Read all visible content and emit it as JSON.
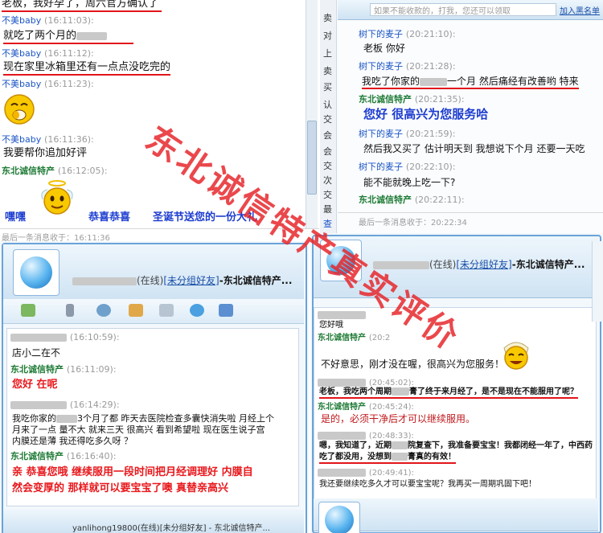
{
  "panel1": {
    "msgs": [
      {
        "text": "老板，我好孕了，周六官方确认了"
      },
      {
        "nick": "不美baby",
        "time": "(16:11:03):"
      },
      {
        "text": "就吃了两个月的"
      },
      {
        "nick": "不美baby",
        "time": "(16:11:12):"
      },
      {
        "text": "现在家里冰箱里还有一点点没吃完的"
      },
      {
        "nick": "不美baby",
        "time": "(16:11:23):"
      },
      {
        "nick": "不美baby",
        "time": "(16:11:36):"
      },
      {
        "text": "我要帮你追加好评"
      },
      {
        "nick": "东北诚信特产",
        "time": "(16:12:05):"
      },
      {
        "text": "嘿嘿"
      },
      {
        "text": "恭喜恭喜"
      },
      {
        "text": "圣诞节送您的一份大礼"
      }
    ],
    "status": "最后一条消息收于：16:11:36"
  },
  "panel2": {
    "top_link": "如果不能收款的，打我，您还可以领取",
    "top_link2": "加入黑名单",
    "side_chars": [
      "卖",
      "对",
      "上",
      "卖",
      "买",
      "认",
      "交",
      "会",
      "会",
      "交",
      "次",
      "交",
      "最",
      "查"
    ],
    "msgs": [
      {
        "nick": "树下的麦子",
        "time": "(20:21:10):"
      },
      {
        "text": "老板 你好"
      },
      {
        "nick": "树下的麦子",
        "time": "(20:21:28):"
      },
      {
        "text_a": "我吃了你家的",
        "text_b": "一个月 然后痛经有改善哟 特来"
      },
      {
        "nick": "东北诚信特产",
        "time": "(20:21:35):"
      },
      {
        "text": "您好  很高兴为您服务哈"
      },
      {
        "nick": "树下的麦子",
        "time": "(20:21:59):"
      },
      {
        "text": "然后我又买了 估计明天到 我想说下个月 还要一天吃"
      },
      {
        "nick": "树下的麦子",
        "time": "(20:22:10):"
      },
      {
        "text": "能不能就晚上吃一下?"
      },
      {
        "nick": "东北诚信特产",
        "time": "(20:22:11):"
      }
    ],
    "status": "最后一条消息收于：20:22:34"
  },
  "panel3": {
    "title_online": "(在线)",
    "title_group": "[未分组好友]",
    "title_name": "-东北诚信特产...",
    "msgs": [
      {
        "time": "(16:10:59):"
      },
      {
        "text": "店小二在不"
      },
      {
        "nick": "东北诚信特产",
        "time": "(16:11:09):"
      },
      {
        "text": "您好  在呢"
      },
      {
        "time": "(16:14:29):"
      },
      {
        "text": "我吃你家的",
        "text2": "3个月了都  昨天去医院检查多囊快消失啦  月经上个"
      },
      {
        "text": "月来了一点  量不大  就来三天  很高兴  看到希望啦  现在医生说子宫"
      },
      {
        "text": "内膜还是薄  我还得吃多久呀 ？"
      },
      {
        "nick": "东北诚信特产",
        "time": "(16:16:40):"
      },
      {
        "text": "亲  恭喜您哦  继续服用一段时间把月经调理好  内膜自"
      },
      {
        "text": "然会变厚的  那样就可以要宝宝了噢  真替亲高兴"
      }
    ],
    "bottom_title": "yanlihong19800(在线)[未分组好友] - 东北诚信特产..."
  },
  "panel4": {
    "title_online": "(在线)",
    "title_group": "[未分组好友]",
    "title_name": "-东北诚信特产...",
    "msgs": [
      {
        "text": "您好哦"
      },
      {
        "nick": "东北诚信特产",
        "time": "(20:2"
      },
      {
        "text": "不好意思，刚才没在喔，很高兴为您服务！"
      },
      {
        "time": "(20:45:02):"
      },
      {
        "text": "老板，我吃两个周期",
        "text2": "膏了终于来月经了，是不是现在不能服用了呢？"
      },
      {
        "nick": "东北诚信特产",
        "time": "(20:45:24):"
      },
      {
        "text": "是的，必须干净后才可以继续服用。"
      },
      {
        "time": "(20:48:33):"
      },
      {
        "text": "嗯，我知道了，近期",
        "text2": "院复查下，我准备要宝宝！我都闭经一年了，中西药"
      },
      {
        "text": "吃了都没用，没想到",
        "text2": "膏真的有效！"
      },
      {
        "time": "(20:49:41):"
      },
      {
        "text": "我还要继续吃多久才可以要宝宝呢？我再买一周期巩固下吧！"
      }
    ]
  },
  "watermark": "东北诚信特产真实评价",
  "icons": [
    "smiley-icon",
    "angel-smiley-icon",
    "qq-penguin-avatar-icon",
    "laughing-smiley-icon"
  ],
  "colors": {
    "accent_red": "#e1151b",
    "nick_blue": "#1a55c4",
    "nick_green": "#1d7a34",
    "window_border": "#6aa3d8"
  }
}
